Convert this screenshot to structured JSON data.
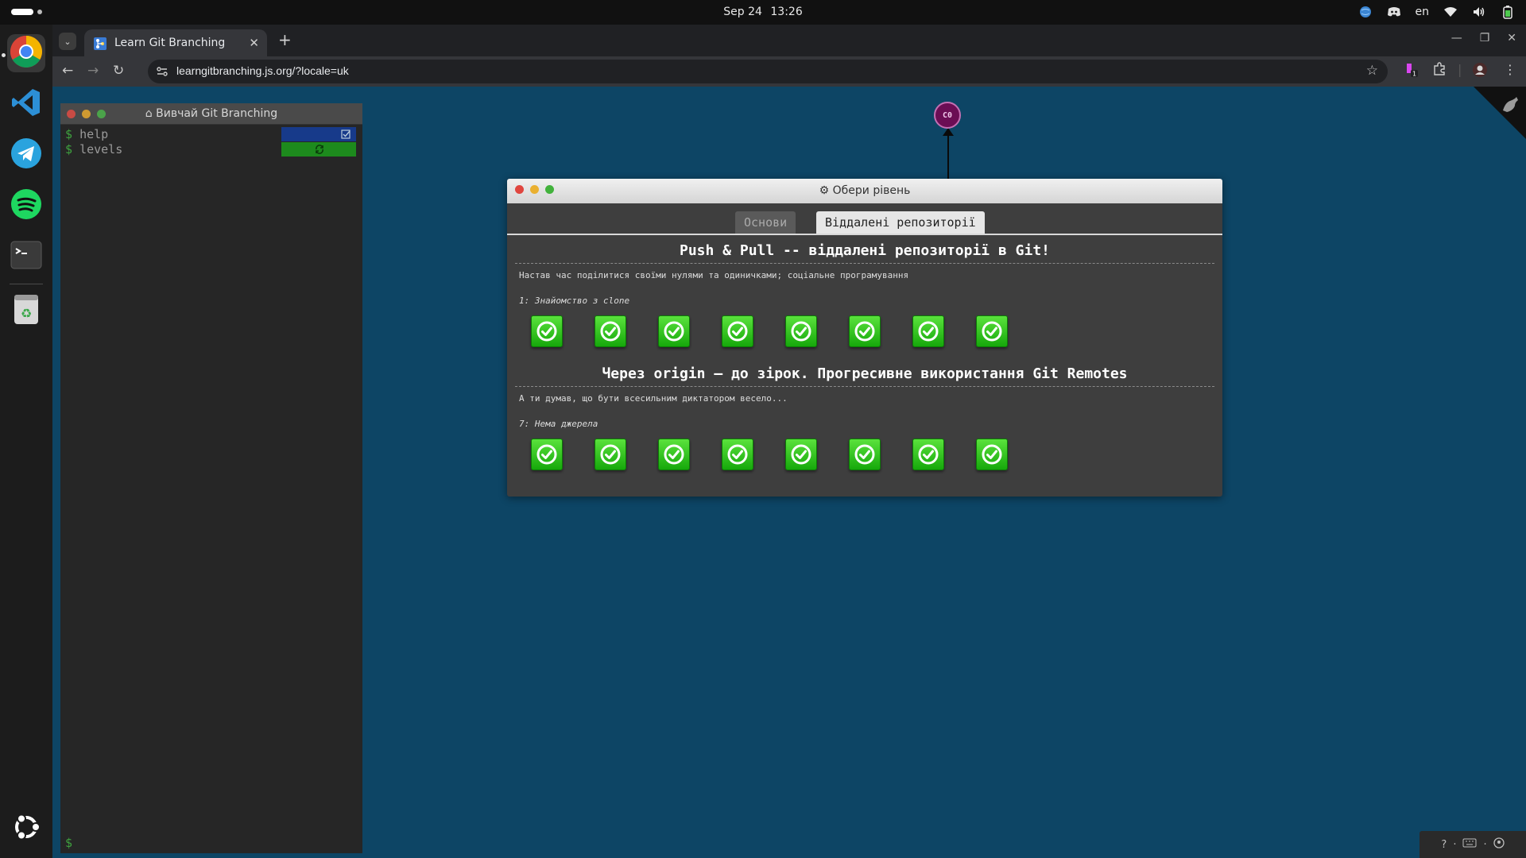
{
  "topbar": {
    "date": "Sep 24",
    "time": "13:26",
    "language": "en"
  },
  "dock": {
    "apps": [
      "chrome",
      "vscode",
      "telegram",
      "spotify",
      "terminal",
      "trash",
      "ubuntu-apps"
    ]
  },
  "browser": {
    "tab_title": "Learn Git Branching",
    "url": "learngitbranching.js.org/?locale=uk",
    "extension_badge": "1"
  },
  "terminal": {
    "title": "Вивчай Git Branching",
    "commands": [
      {
        "prompt": "$",
        "text": "help"
      },
      {
        "prompt": "$",
        "text": "levels"
      }
    ],
    "input_prompt": "$",
    "colors": {
      "help_flag": "#173a8a",
      "levels_flag": "#1d8a1d"
    }
  },
  "graph": {
    "commit_label": "C0",
    "commit_color": "#6b0d54"
  },
  "dialog": {
    "title": "Обери рівень",
    "tabs": [
      {
        "label": "Основи",
        "active": false
      },
      {
        "label": "Віддалені репозиторії",
        "active": true
      }
    ],
    "sequences": [
      {
        "title": "Push & Pull -- віддалені репозиторії в Git!",
        "about": "Настав час поділитися своїми нулями та одиничками; соціальне програмування",
        "level": "1: Знайомство з clone",
        "levels_completed": 8
      },
      {
        "title": "Через origin — до зірок. Прогресивне використання Git Remotes",
        "about": "А ти думав, що бути всесильним диктатором весело...",
        "level": "7: Нема джерела",
        "levels_completed": 8
      }
    ],
    "complete_color": "#2ec41e"
  },
  "helpbar": {
    "items": [
      "?",
      "keyboard",
      "github"
    ]
  }
}
